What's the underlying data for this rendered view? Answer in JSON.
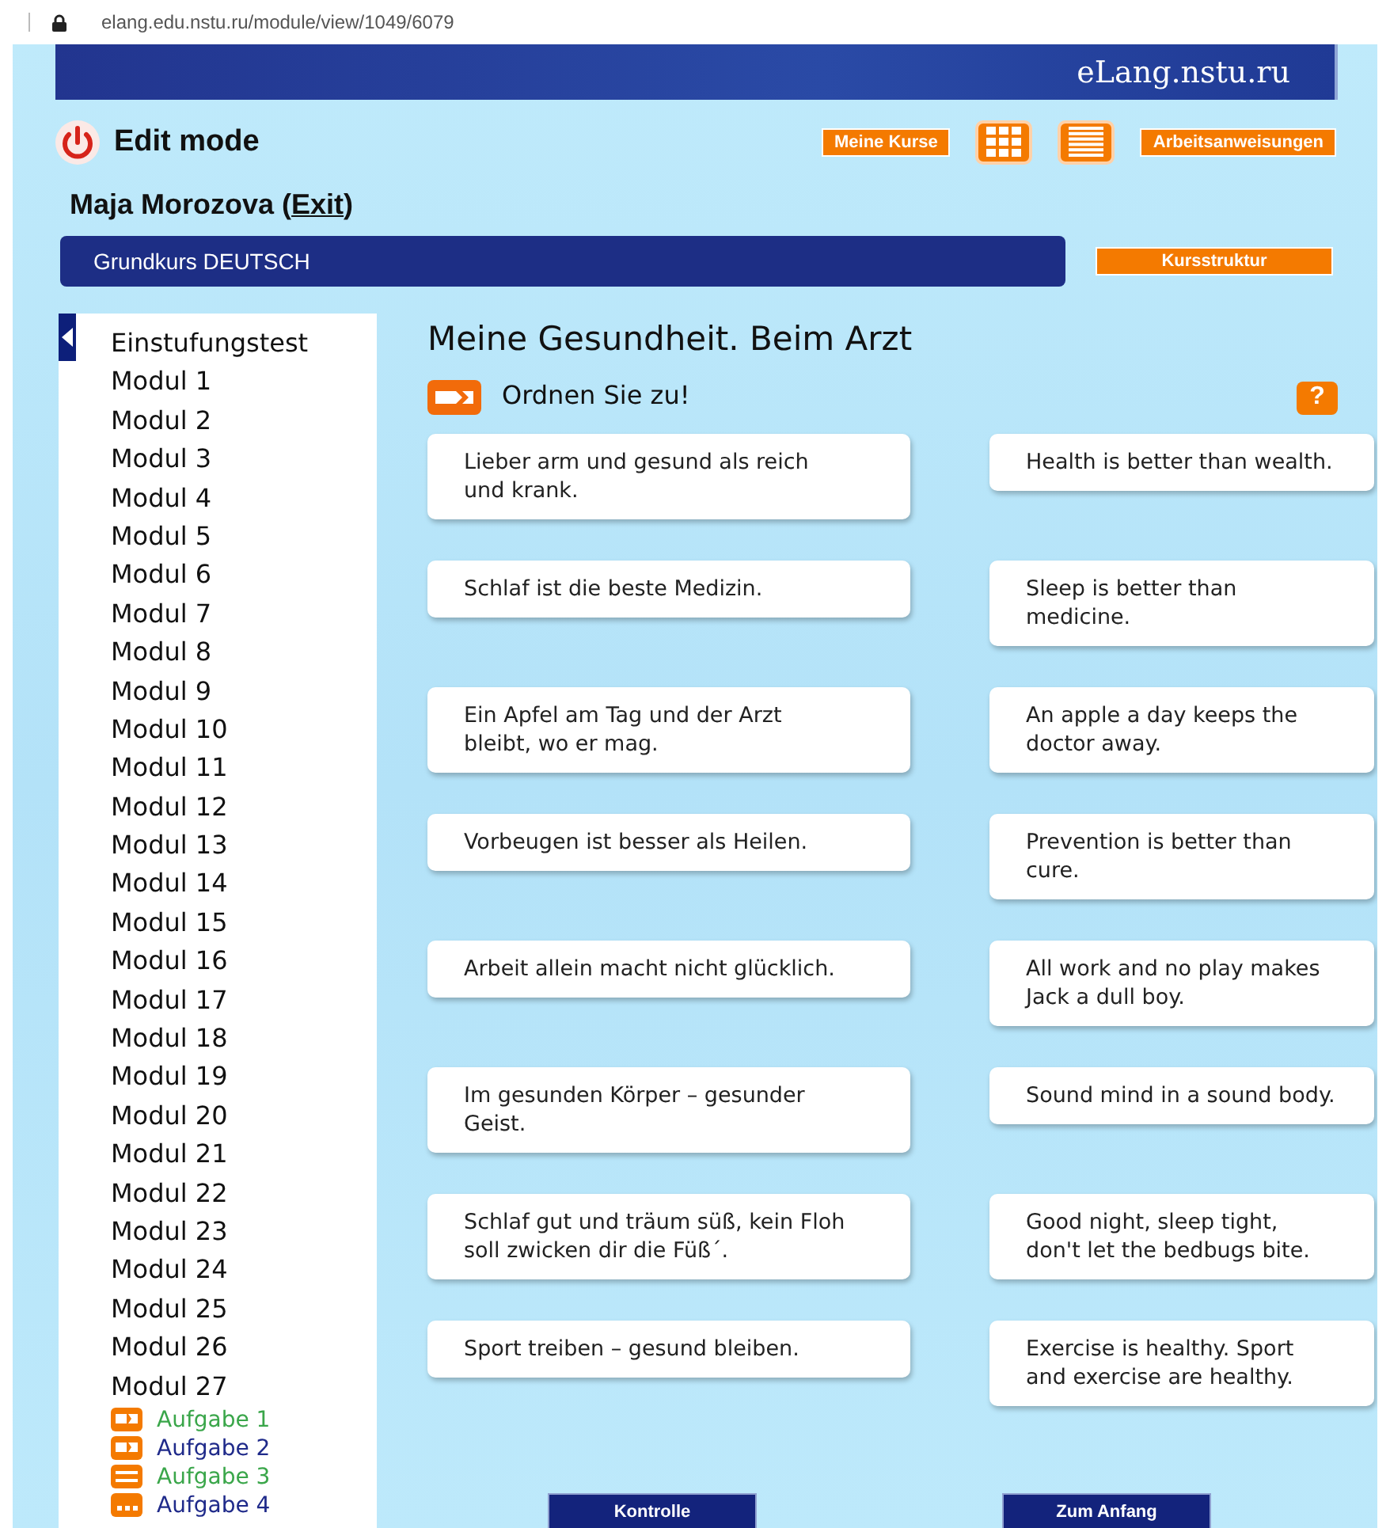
{
  "address_bar": {
    "url": "elang.edu.nstu.ru/module/view/1049/6079"
  },
  "banner": {
    "site_name": "eLang.nstu.ru"
  },
  "header": {
    "mode_label": "Edit mode",
    "buttons": [
      {
        "kind": "text",
        "label": "Meine Kurse"
      },
      {
        "kind": "grid"
      },
      {
        "kind": "list"
      },
      {
        "kind": "text",
        "label": "Arbeitsanweisungen"
      }
    ]
  },
  "user": {
    "name": "Maja Morozova",
    "paren_open": "(",
    "exit_link": "Exit",
    "paren_close": ")"
  },
  "course_bar": {
    "title": "Grundkurs DEUTSCH",
    "button": "Kursstruktur"
  },
  "sidebar": {
    "items": [
      {
        "label": "Einstufungstest"
      },
      {
        "label": "Modul 1"
      },
      {
        "label": "Modul 2"
      },
      {
        "label": "Modul 3"
      },
      {
        "label": "Modul 4"
      },
      {
        "label": "Modul 5"
      },
      {
        "label": "Modul 6"
      },
      {
        "label": "Modul 7"
      },
      {
        "label": "Modul 8"
      },
      {
        "label": "Modul 9"
      },
      {
        "label": "Modul 10"
      },
      {
        "label": "Modul 11"
      },
      {
        "label": "Modul 12"
      },
      {
        "label": "Modul 13"
      },
      {
        "label": "Modul 14"
      },
      {
        "label": "Modul 15"
      },
      {
        "label": "Modul 16"
      },
      {
        "label": "Modul 17"
      },
      {
        "label": "Modul 18"
      },
      {
        "label": "Modul 19"
      },
      {
        "label": "Modul 20"
      },
      {
        "label": "Modul 21"
      },
      {
        "label": "Modul 22"
      },
      {
        "label": "Modul 23"
      },
      {
        "label": "Modul 24"
      },
      {
        "label": "Modul 25"
      },
      {
        "label": "Modul 26"
      },
      {
        "label": "Modul 27",
        "children": [
          {
            "label": "Aufgabe 1",
            "kind": "match",
            "color": "#3aa64a"
          },
          {
            "label": "Aufgabe 2",
            "kind": "match",
            "color": "#1f2a8a"
          },
          {
            "label": "Aufgabe 3",
            "kind": "lines",
            "color": "#3aa64a"
          },
          {
            "label": "Aufgabe 4",
            "kind": "dots",
            "color": "#1f2a8a"
          }
        ]
      }
    ]
  },
  "exercise": {
    "title": "Meine Gesundheit. Beim Arzt",
    "instruction": "Ordnen Sie zu!",
    "help": "?",
    "pairs": [
      {
        "left": "Lieber arm und gesund als reich und krank.",
        "right": "Health is better than wealth."
      },
      {
        "left": "Schlaf ist die beste Medizin.",
        "right": "Sleep is better than medicine."
      },
      {
        "left": "Ein Apfel am Tag und der Arzt bleibt, wo er mag.",
        "right": "An apple a day keeps the doctor away."
      },
      {
        "left": "Vorbeugen ist besser als Heilen.",
        "right": "Prevention is better than cure."
      },
      {
        "left": "Arbeit allein macht nicht glücklich.",
        "right": "All work and no play makes Jack a dull boy."
      },
      {
        "left": "Im gesunden Körper – gesunder Geist.",
        "right": "Sound mind in a sound body."
      },
      {
        "left": "Schlaf gut und träum süß, kein Floh soll zwicken dir die Füß´.",
        "right": "Good night, sleep tight, don't let the bedbugs bite."
      },
      {
        "left": "Sport treiben – gesund bleiben.",
        "right": "Exercise is healthy. Sport and exercise are healthy."
      }
    ],
    "buttons": [
      "Kontrolle",
      "Zum Anfang"
    ]
  }
}
